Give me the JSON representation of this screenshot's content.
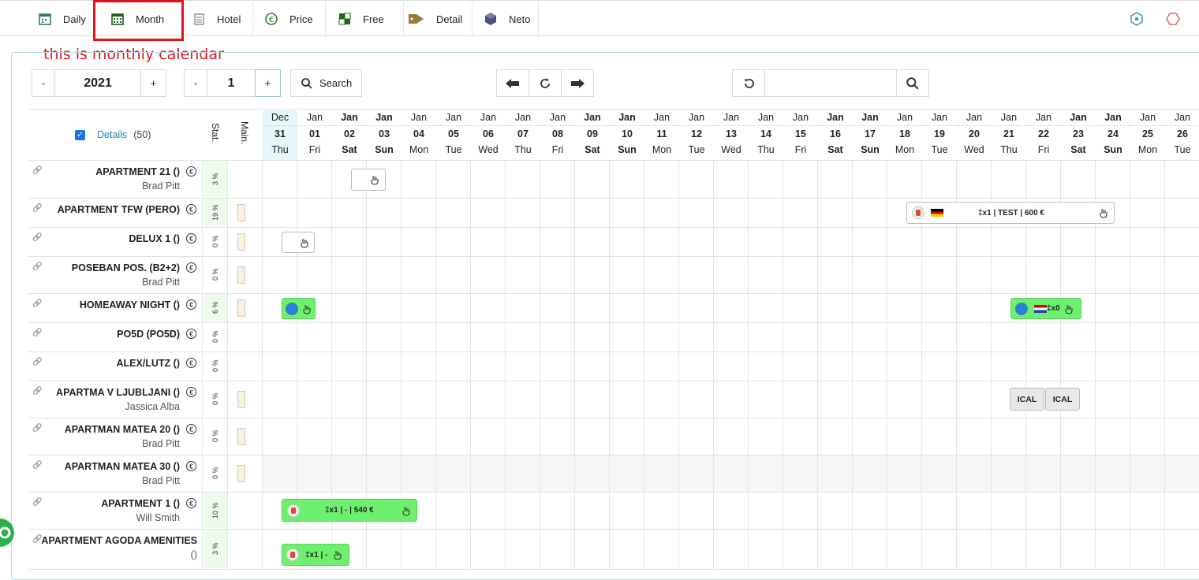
{
  "tabs": [
    {
      "label": "Daily",
      "icon": "calendar-icon"
    },
    {
      "label": "Month",
      "icon": "calendar-grid-icon"
    },
    {
      "label": "Hotel",
      "icon": "document-icon"
    },
    {
      "label": "Price",
      "icon": "euro-icon"
    },
    {
      "label": "Free",
      "icon": "checker-icon"
    },
    {
      "label": "Detail",
      "icon": "tag-icon"
    },
    {
      "label": "Neto",
      "icon": "cube-icon"
    }
  ],
  "annotation": "this is monthly calendar",
  "controls": {
    "year_minus": "-",
    "year": "2021",
    "year_plus": "+",
    "month_minus": "-",
    "month": "1",
    "month_plus": "+",
    "search": "Search"
  },
  "details_label": "Details",
  "details_count": "(50)",
  "stat_label": "Stat.",
  "main_label": "Main.",
  "days": [
    {
      "m": "Dec",
      "d": "31",
      "w": "Thu"
    },
    {
      "m": "Jan",
      "d": "01",
      "w": "Fri"
    },
    {
      "m": "Jan",
      "d": "02",
      "w": "Sat"
    },
    {
      "m": "Jan",
      "d": "03",
      "w": "Sun"
    },
    {
      "m": "Jan",
      "d": "04",
      "w": "Mon"
    },
    {
      "m": "Jan",
      "d": "05",
      "w": "Tue"
    },
    {
      "m": "Jan",
      "d": "06",
      "w": "Wed"
    },
    {
      "m": "Jan",
      "d": "07",
      "w": "Thu"
    },
    {
      "m": "Jan",
      "d": "08",
      "w": "Fri"
    },
    {
      "m": "Jan",
      "d": "09",
      "w": "Sat"
    },
    {
      "m": "Jan",
      "d": "10",
      "w": "Sun"
    },
    {
      "m": "Jan",
      "d": "11",
      "w": "Mon"
    },
    {
      "m": "Jan",
      "d": "12",
      "w": "Tue"
    },
    {
      "m": "Jan",
      "d": "13",
      "w": "Wed"
    },
    {
      "m": "Jan",
      "d": "14",
      "w": "Thu"
    },
    {
      "m": "Jan",
      "d": "15",
      "w": "Fri"
    },
    {
      "m": "Jan",
      "d": "16",
      "w": "Sat"
    },
    {
      "m": "Jan",
      "d": "17",
      "w": "Sun"
    },
    {
      "m": "Jan",
      "d": "18",
      "w": "Mon"
    },
    {
      "m": "Jan",
      "d": "19",
      "w": "Tue"
    },
    {
      "m": "Jan",
      "d": "20",
      "w": "Wed"
    },
    {
      "m": "Jan",
      "d": "21",
      "w": "Thu"
    },
    {
      "m": "Jan",
      "d": "22",
      "w": "Fri"
    },
    {
      "m": "Jan",
      "d": "23",
      "w": "Sat"
    },
    {
      "m": "Jan",
      "d": "24",
      "w": "Sun"
    },
    {
      "m": "Jan",
      "d": "25",
      "w": "Mon"
    },
    {
      "m": "Jan",
      "d": "26",
      "w": "Tue"
    }
  ],
  "rows": [
    {
      "name": "APARTMENT 21 ()",
      "owner": "Brad Pitt",
      "stat": "3 %"
    },
    {
      "name": "APARTMENT TFW (PERO)",
      "owner": "",
      "stat": "19 %"
    },
    {
      "name": "DELUX 1 ()",
      "owner": "",
      "stat": "0 %"
    },
    {
      "name": "POSEBAN POS. (B2+2)",
      "owner": "Brad Pitt",
      "stat": "0 %"
    },
    {
      "name": "HOMEAWAY NIGHT ()",
      "owner": "",
      "stat": "6 %"
    },
    {
      "name": "PO5D (PO5D)",
      "owner": "",
      "stat": "0 %"
    },
    {
      "name": "ALEX/LUTZ ()",
      "owner": "",
      "stat": "0 %"
    },
    {
      "name": "APARTMA V LJUBLJANI ()",
      "owner": "Jassica Alba",
      "stat": "0 %"
    },
    {
      "name": "APARTMAN MATEA 20 ()",
      "owner": "Brad Pitt",
      "stat": "0 %"
    },
    {
      "name": "APARTMAN MATEA 30 ()",
      "owner": "Brad Pitt",
      "stat": "0 %"
    },
    {
      "name": "APARTMENT 1 ()",
      "owner": "Will Smith",
      "stat": "10 %"
    },
    {
      "name": "APARTMENT AGODA AMENITIES",
      "owner": "()",
      "stat": "3 %"
    }
  ],
  "reservations": {
    "r1": "‡x1 | TEST | 600 €",
    "r2": "‡x0",
    "r3": "‡x1 | - | 540 €",
    "r4": "‡x1 | -",
    "ical": "ICAL"
  }
}
